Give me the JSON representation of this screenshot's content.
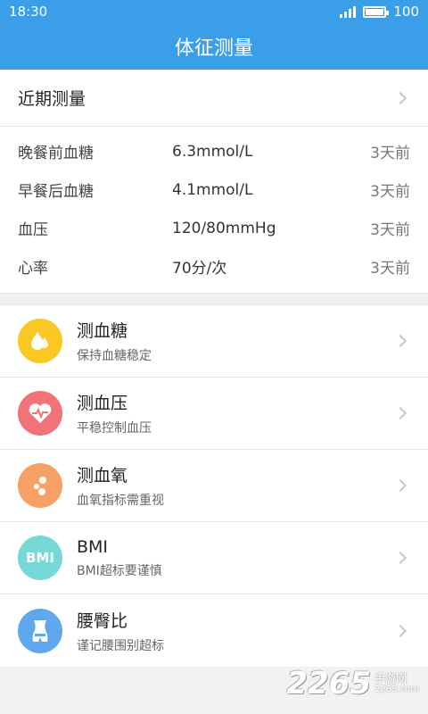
{
  "status_bar": {
    "time": "18:30",
    "battery": "100"
  },
  "header": {
    "title": "体征测量"
  },
  "recent": {
    "title": "近期测量",
    "rows": [
      {
        "name": "晚餐前血糖",
        "value": "6.3mmol/L",
        "time": "3天前"
      },
      {
        "name": "早餐后血糖",
        "value": "4.1mmol/L",
        "time": "3天前"
      },
      {
        "name": "血压",
        "value": "120/80mmHg",
        "time": "3天前"
      },
      {
        "name": "心率",
        "value": "70分/次",
        "time": "3天前"
      }
    ]
  },
  "menu": [
    {
      "title": "测血糖",
      "subtitle": "保持血糖稳定",
      "icon": "water-drop-icon",
      "color": "#f9c822"
    },
    {
      "title": "测血压",
      "subtitle": "平稳控制血压",
      "icon": "heart-pulse-icon",
      "color": "#f0737a"
    },
    {
      "title": "测血氧",
      "subtitle": "血氧指标需重视",
      "icon": "bubbles-icon",
      "color": "#f7a065"
    },
    {
      "title": "BMI",
      "subtitle": "BMI超标要谨慎",
      "icon": "bmi-icon",
      "icon_text": "BMI",
      "color": "#76d9d8"
    },
    {
      "title": "腰臀比",
      "subtitle": "谨记腰围别超标",
      "icon": "body-icon",
      "color": "#5fa8ee"
    }
  ],
  "watermark": {
    "number": "2265",
    "text_top": "手游网",
    "text_bottom": "2265.com"
  }
}
